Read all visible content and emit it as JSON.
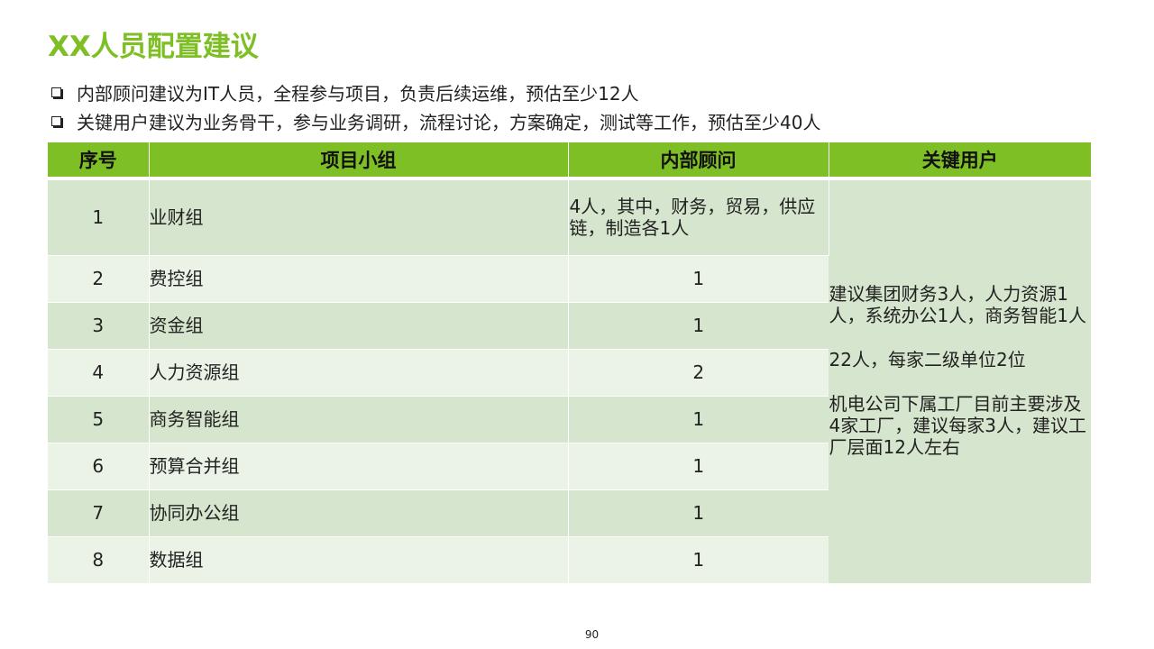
{
  "title": "XX人员配置建议",
  "bullets": [
    "内部顾问建议为IT人员，全程参与项目，负责后续运维，预估至少12人",
    "关键用户建议为业务骨干，参与业务调研，流程讨论，方案确定，测试等工作，预估至少40人"
  ],
  "table": {
    "headers": [
      "序号",
      "项目小组",
      "内部顾问",
      "关键用户"
    ],
    "rows": [
      {
        "no": "1",
        "group": "业财组",
        "advisor": "4人，其中，财务，贸易，供应链，制造各1人"
      },
      {
        "no": "2",
        "group": "费控组",
        "advisor": "1"
      },
      {
        "no": "3",
        "group": "资金组",
        "advisor": "1"
      },
      {
        "no": "4",
        "group": "人力资源组",
        "advisor": "2"
      },
      {
        "no": "5",
        "group": "商务智能组",
        "advisor": "1"
      },
      {
        "no": "6",
        "group": "预算合并组",
        "advisor": "1"
      },
      {
        "no": "7",
        "group": "协同办公组",
        "advisor": "1"
      },
      {
        "no": "8",
        "group": "数据组",
        "advisor": "1"
      }
    ],
    "key_users": [
      "建议集团财务3人，人力资源1人，系统办公1人，商务智能1人",
      "22人，每家二级单位2位",
      "机电公司下属工厂目前主要涉及4家工厂，建议每家3人，建议工厂层面12人左右"
    ]
  },
  "page_number": "90",
  "colors": {
    "accent": "#7fbf26",
    "row_dark": "#d6e5cd",
    "row_light": "#ebf2e6"
  }
}
